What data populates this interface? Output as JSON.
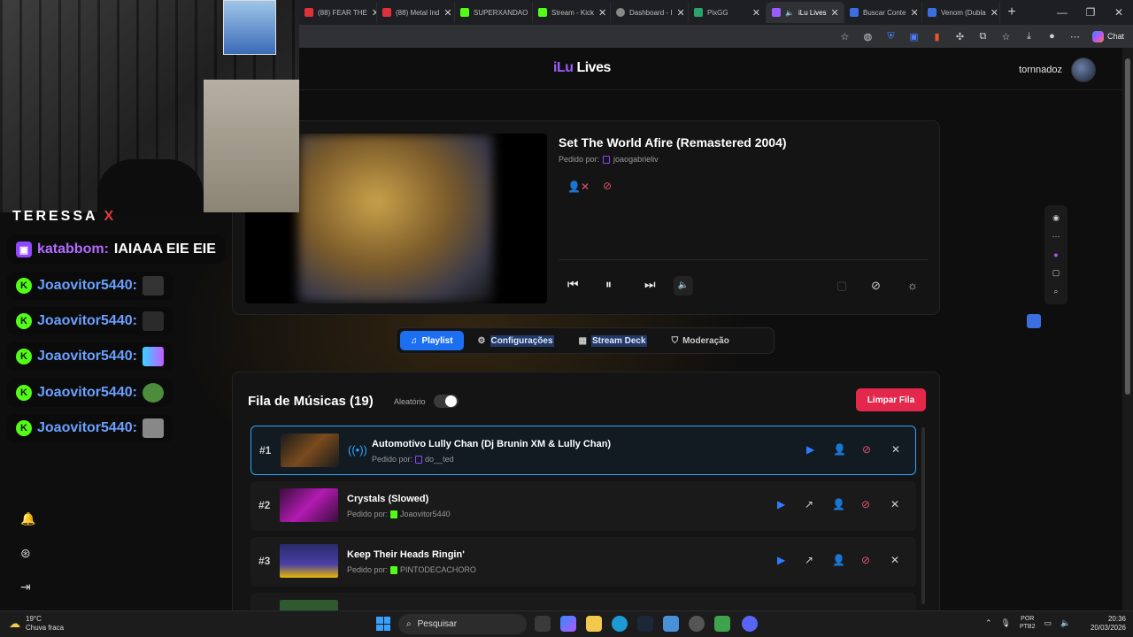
{
  "browser": {
    "tabs": [
      {
        "label": "(88) FEAR THE",
        "color": "#e0303a"
      },
      {
        "label": "(88) Metal Ind",
        "color": "#e0303a"
      },
      {
        "label": "SUPERXANDAO",
        "color": "#53fc18"
      },
      {
        "label": "Stream - Kick",
        "color": "#53fc18"
      },
      {
        "label": "Dashboard - I",
        "color": "#888888"
      },
      {
        "label": "PixGG",
        "color": "#2aa36b"
      },
      {
        "label": "iLu Lives",
        "color": "#9b5cff",
        "active": true
      },
      {
        "label": "Buscar Conte",
        "color": "#3b6fe0"
      },
      {
        "label": "Venom (Dubla",
        "color": "#3b6fe0"
      }
    ],
    "chat_label": "Chat"
  },
  "header": {
    "logo_part1": "iLu",
    "logo_part2": " Lives",
    "username": "tornnadoz"
  },
  "player": {
    "song_title": "Set The World Afire (Remastered 2004)",
    "requested_by_label": "Pedido por:",
    "requester": "joaogabrieliv"
  },
  "tabs": {
    "playlist": "Playlist",
    "settings": "Configurações",
    "stream_deck": "Stream Deck",
    "moderation": "Moderação"
  },
  "queue": {
    "title": "Fila de Músicas (19)",
    "shuffle_label": "Aleatório",
    "shuffle_on": false,
    "clear_label": "Limpar Fila",
    "items": [
      {
        "pos": "#1",
        "title": "Automotivo Lully Chan (Dj Brunin XM & Lully Chan)",
        "requester": "do__ted",
        "platform": "twitch",
        "playing": true
      },
      {
        "pos": "#2",
        "title": "Crystals (Slowed)",
        "requester": "Joaovitor5440",
        "platform": "kick",
        "playing": false
      },
      {
        "pos": "#3",
        "title": "Keep Their Heads Ringin'",
        "requester": "PINTODECACHORO",
        "platform": "kick",
        "playing": false
      }
    ]
  },
  "overlay": {
    "cam_label": "TERESSA",
    "cam_label_x": "X",
    "chat": [
      {
        "platform": "twitch",
        "user": "katabbom:",
        "message": "IAIAAA EIE EIE"
      },
      {
        "platform": "kick",
        "user": "Joaovitor5440:",
        "message": ""
      },
      {
        "platform": "kick",
        "user": "Joaovitor5440:",
        "message": ""
      },
      {
        "platform": "kick",
        "user": "Joaovitor5440:",
        "message": ""
      },
      {
        "platform": "kick",
        "user": "Joaovitor5440:",
        "message": ""
      },
      {
        "platform": "kick",
        "user": "Joaovitor5440:",
        "message": ""
      }
    ]
  },
  "taskbar": {
    "temp": "19°C",
    "weather": "Chuva fraca",
    "search_placeholder": "Pesquisar",
    "lang_top": "POR",
    "lang_bottom": "PTB2",
    "time": "20:36",
    "date": "20/03/2026"
  }
}
